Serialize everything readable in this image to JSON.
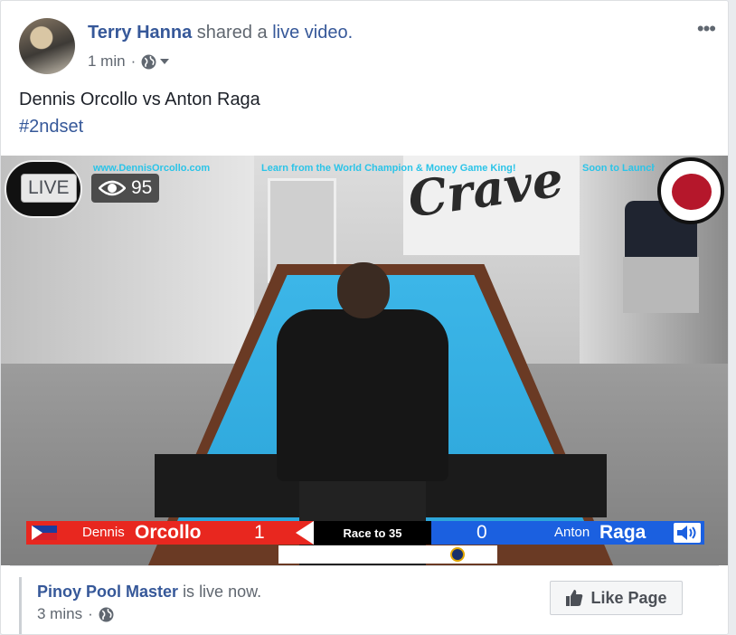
{
  "post": {
    "author": "Terry Hanna",
    "action": "shared a",
    "action_link": "live video.",
    "time": "1 min",
    "separator": "·",
    "text": "Dennis Orcollo vs Anton Raga",
    "hashtag": "#2ndset",
    "more_label": "•••"
  },
  "video": {
    "live_label": "LIVE",
    "viewer_count": "95",
    "overlay_site": "www.DennisOrcollo.com",
    "overlay_tagline": "Learn from the World Champion & Money Game King!",
    "overlay_soon": "Soon to Launch",
    "crave_logo": "Crave",
    "scoreboard": {
      "player1_first": "Dennis",
      "player1_last": "Orcollo",
      "player1_score": "1",
      "race": "Race to 35",
      "player2_score": "0",
      "player2_first": "Anton",
      "player2_last": "Raga"
    }
  },
  "shared_page": {
    "name": "Pinoy Pool Master",
    "status": "is live now.",
    "time": "3 mins",
    "separator": "·",
    "like_button": "Like Page"
  },
  "colors": {
    "link": "#365899",
    "score_red": "#e8271f",
    "score_blue": "#1b60e0",
    "felt": "#2aa3d8"
  }
}
